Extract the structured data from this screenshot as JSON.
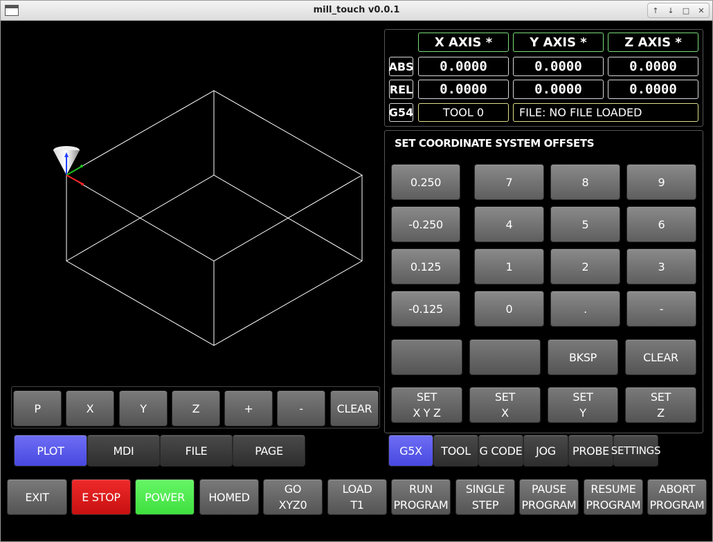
{
  "window": {
    "title": "mill_touch v0.0.1",
    "controls": [
      "↑",
      "↓",
      "□",
      "✕"
    ]
  },
  "dro": {
    "headers": [
      "X AXIS *",
      "Y AXIS *",
      "Z AXIS *"
    ],
    "abs_label": "ABS",
    "rel_label": "REL",
    "wcs_label": "G54",
    "abs_values": [
      "0.0000",
      "0.0000",
      "0.0000"
    ],
    "rel_values": [
      "0.0000",
      "0.0000",
      "0.0000"
    ],
    "tool": "TOOL 0",
    "file": "FILE: NO FILE LOADED"
  },
  "offsets": {
    "title": "SET COORDINATE SYSTEM OFFSETS",
    "presets": [
      "0.250",
      "-0.250",
      "0.125",
      "-0.125"
    ],
    "keys": [
      "7",
      "8",
      "9",
      "4",
      "5",
      "6",
      "1",
      "2",
      "3",
      "0",
      ".",
      "-"
    ],
    "row5": [
      "",
      "",
      "BKSP",
      "CLEAR"
    ],
    "set_buttons": [
      "SET\nX Y Z",
      "SET\nX",
      "SET\nY",
      "SET\nZ"
    ]
  },
  "view_buttons": [
    "P",
    "X",
    "Y",
    "Z",
    "+",
    "-",
    "CLEAR"
  ],
  "left_tabs": [
    "PLOT",
    "MDI",
    "FILE",
    "PAGE"
  ],
  "left_tab_active": "PLOT",
  "right_tabs": [
    "G5X",
    "TOOL",
    "G CODE",
    "JOG",
    "PROBE",
    "SETTINGS"
  ],
  "right_tab_active": "G5X",
  "bottom_buttons": [
    "EXIT",
    "E STOP",
    "POWER",
    "HOMED",
    "GO\nXYZ0",
    "LOAD\nT1",
    "RUN\nPROGRAM",
    "SINGLE\nSTEP",
    "PAUSE\nPROGRAM",
    "RESUME\nPROGRAM",
    "ABORT\nPROGRAM"
  ],
  "colors": {
    "active_tab": "#5a5aee",
    "estop": "#e01818",
    "power": "#55ee55",
    "axis_x": "#ff2020",
    "axis_y": "#20c020",
    "axis_z": "#2040ff"
  }
}
